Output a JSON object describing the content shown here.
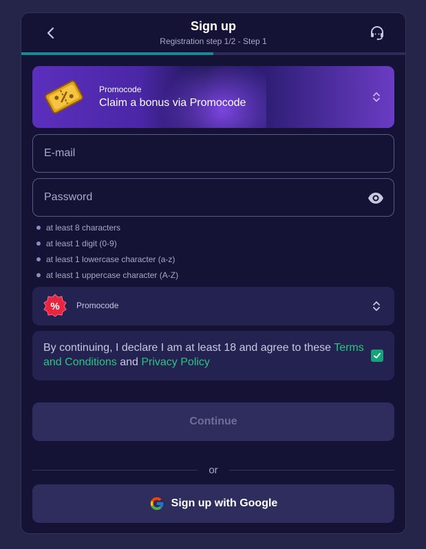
{
  "header": {
    "title": "Sign up",
    "subtitle": "Registration step 1/2 - Step 1",
    "back_icon": "chevron-left-icon",
    "support_icon": "headset-icon",
    "progress": 0.5,
    "progress_color": "#178a94"
  },
  "promo_banner": {
    "label": "Promocode",
    "text": "Claim a bonus via Promocode",
    "icon": "ticket-icon",
    "chevron_icon": "chevron-updown-icon"
  },
  "form": {
    "email_placeholder": "E-mail",
    "email_value": "",
    "password_placeholder": "Password",
    "password_value": "",
    "password_toggle_icon": "eye-icon",
    "password_rules": [
      "at least 8 characters",
      "at least 1 digit (0-9)",
      "at least 1 lowercase character (a-z)",
      "at least 1 uppercase character (A-Z)"
    ]
  },
  "promocode_field": {
    "label": "Promocode",
    "icon": "percent-badge-icon",
    "chevron_icon": "chevron-updown-icon"
  },
  "terms": {
    "text_before": "By continuing, I declare I am at least 18 and agree to these ",
    "terms_link": "Terms and Conditions",
    "and": " and ",
    "privacy_link": "Privacy Policy",
    "checked": true,
    "link_color": "#2cc57e"
  },
  "actions": {
    "continue_label": "Continue",
    "or_label": "or",
    "google_label": "Sign up with Google",
    "google_icon": "google-icon"
  }
}
